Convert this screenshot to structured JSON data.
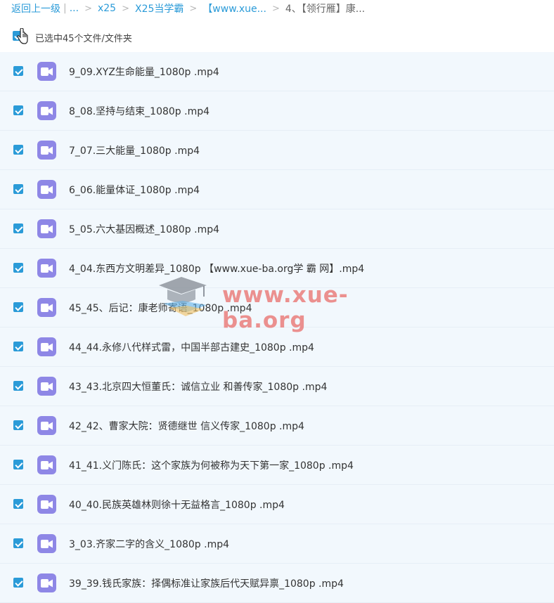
{
  "breadcrumb": {
    "back": "返回上一级",
    "ellipsis": "...",
    "items": [
      "x25",
      "X25当学霸",
      "【www.xue...",
      "4、【领行雁】康..."
    ]
  },
  "selection": {
    "text": "已选中45个文件/文件夹",
    "all_checked": true
  },
  "files": [
    {
      "name": "9_09.XYZ生命能量_1080p .mp4",
      "checked": true
    },
    {
      "name": "8_08.坚持与结束_1080p .mp4",
      "checked": true
    },
    {
      "name": "7_07.三大能量_1080p .mp4",
      "checked": true
    },
    {
      "name": "6_06.能量体证_1080p .mp4",
      "checked": true
    },
    {
      "name": "5_05.六大基因概述_1080p .mp4",
      "checked": true
    },
    {
      "name": "4_04.东西方文明差异_1080p 【www.xue-ba.org学 霸 网】.mp4",
      "checked": true
    },
    {
      "name": "45_45、后记：康老师寄语_1080p .mp4",
      "checked": true
    },
    {
      "name": "44_44.永修八代样式雷，中国半部古建史_1080p .mp4",
      "checked": true
    },
    {
      "name": "43_43.北京四大恒董氏：诚信立业 和善传家_1080p .mp4",
      "checked": true
    },
    {
      "name": "42_42、曹家大院：贤德继世 信义传家_1080p .mp4",
      "checked": true
    },
    {
      "name": "41_41.义门陈氏：这个家族为何被称为天下第一家_1080p .mp4",
      "checked": true
    },
    {
      "name": "40_40.民族英雄林则徐十无益格言_1080p .mp4",
      "checked": true
    },
    {
      "name": "3_03.齐家二字的含义_1080p .mp4",
      "checked": true
    },
    {
      "name": "39_39.钱氏家族：择偶标准让家族后代天赋异禀_1080p .mp4",
      "checked": true
    }
  ],
  "watermark": {
    "text": "www.xue-ba.org"
  },
  "colors": {
    "accent": "#2b9bd8",
    "file_icon": "#8e87e6",
    "row_bg": "#f2f8fd",
    "watermark": "#e86864"
  }
}
